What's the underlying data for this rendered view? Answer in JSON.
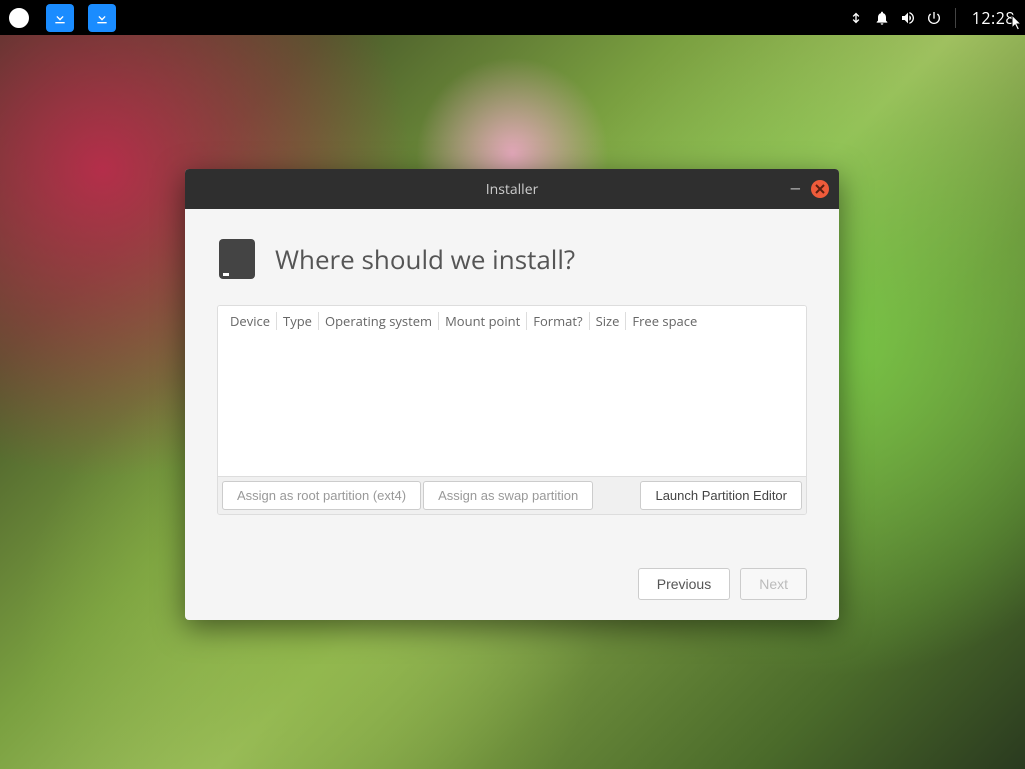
{
  "panel": {
    "clock": "12:28"
  },
  "window": {
    "title": "Installer",
    "heading": "Where should we install?",
    "columns": [
      "Device",
      "Type",
      "Operating system",
      "Mount point",
      "Format?",
      "Size",
      "Free space"
    ],
    "actions": {
      "assign_root": "Assign as root partition (ext4)",
      "assign_swap": "Assign as swap partition",
      "launch_editor": "Launch Partition Editor"
    },
    "nav": {
      "previous": "Previous",
      "next": "Next"
    }
  }
}
